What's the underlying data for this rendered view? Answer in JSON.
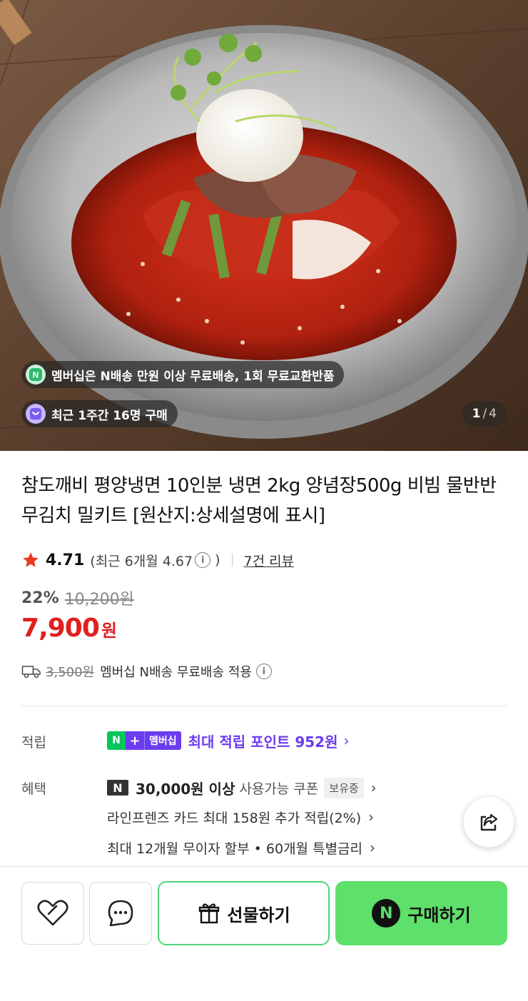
{
  "hero": {
    "badge_membership": "멤버십은 N배송 만원 이상 무료배송, 1회 무료교환반품",
    "badge_recent": "최근 1주간 16명 구매",
    "counter_current": "1",
    "counter_separator": "/",
    "counter_total": "4"
  },
  "product": {
    "title": "참도깨비 평양냉면 10인분 냉면 2kg 양념장500g 비빔 물반반 무김치 밀키트 [원산지:상세설명에 표시]",
    "rating": "4.71",
    "recent_rating_open": "(최근 6개월 4.67",
    "recent_rating_close": ")",
    "review_link": "7건 리뷰",
    "discount_pct": "22%",
    "original_price": "10,200원",
    "price": "7,900",
    "price_unit": "원"
  },
  "shipping": {
    "fee": "3,500원",
    "text": "멤버십 N배송 무료배송 적용"
  },
  "points": {
    "label": "적립",
    "badge_n": "N",
    "badge_plus": "+",
    "badge_member": "멤버십",
    "text": "최대 적립 포인트 952원"
  },
  "benefits": {
    "label": "혜택",
    "n_icon": "N",
    "coupon_amount": "30,000원 이상",
    "coupon_text": "사용가능 쿠폰",
    "coupon_tag": "보유중",
    "card": "라인프렌즈 카드 최대 158원 추가 적립(2%)",
    "installment": "최대 12개월 무이자 할부 • 60개월 특별금리"
  },
  "actions": {
    "gift": "선물하기",
    "buy_icon": "N",
    "buy": "구매하기"
  },
  "icons": {
    "info": "i",
    "chevron": "›"
  },
  "colors": {
    "price_red": "#e0201e",
    "membership_purple": "#6b3cf0",
    "naver_green": "#03c75a",
    "buy_button": "#5ee06a"
  }
}
